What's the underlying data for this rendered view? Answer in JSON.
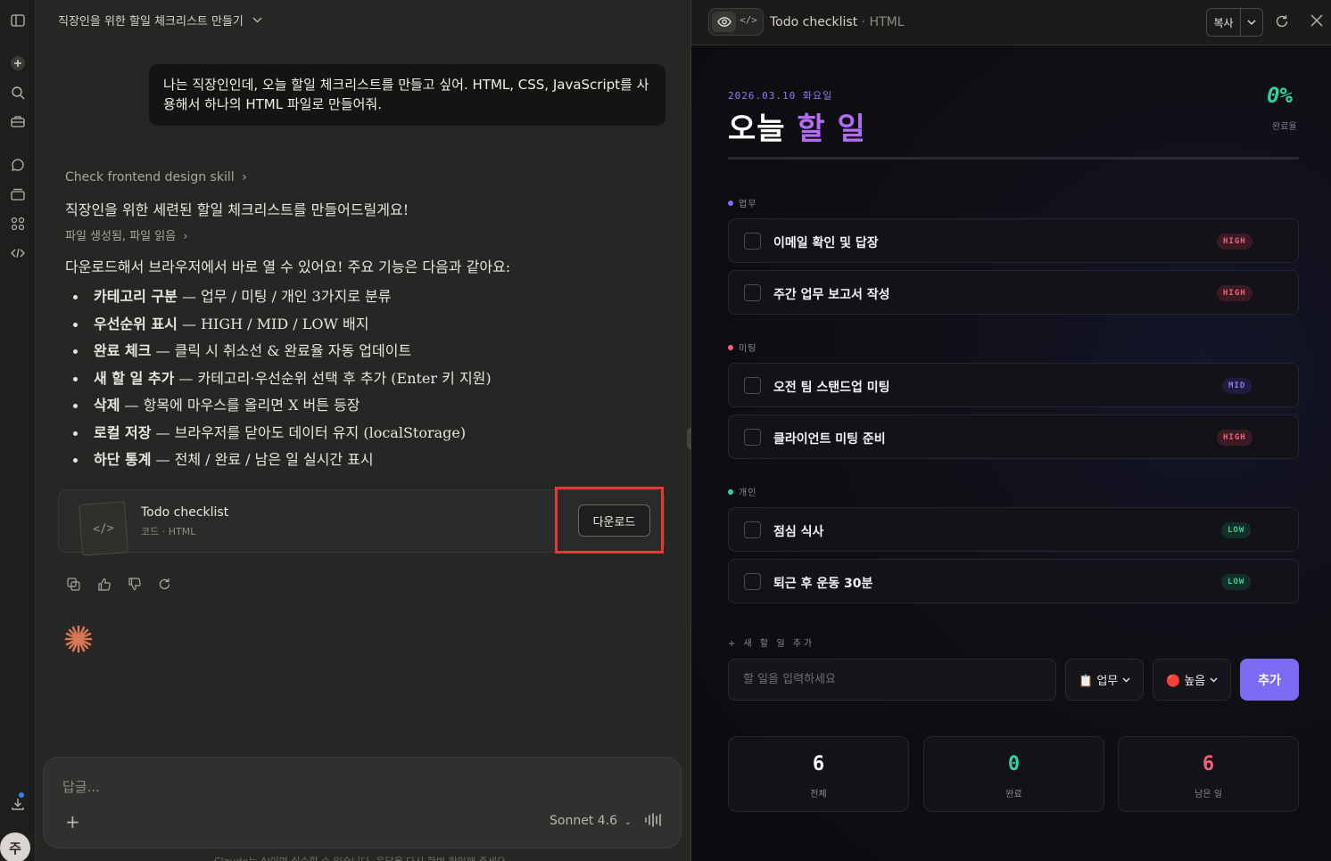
{
  "chat": {
    "title": "직장인을 위한 할일 체크리스트 만들기",
    "user_message": "나는 직장인인데, 오늘 할일 체크리스트를 만들고 싶어. HTML, CSS, JavaScript를 사용해서 하나의 HTML 파일로 만들어줘.",
    "skill_link": "Check frontend design skill",
    "intro": "직장인을 위한 세련된 할일 체크리스트를 만들어드릴게요!",
    "files_link": "파일 생성됨, 파일 읽음",
    "lead": "다운로드해서 브라우저에서 바로 열 수 있어요! 주요 기능은 다음과 같아요:",
    "features": [
      {
        "bold": "카테고리 구분",
        "text": " — 업무 / 미팅 / 개인 3가지로 분류"
      },
      {
        "bold": "우선순위 표시",
        "text": " — HIGH / MID / LOW 배지"
      },
      {
        "bold": "완료 체크",
        "text": " — 클릭 시 취소선 & 완료율 자동 업데이트"
      },
      {
        "bold": "새 할 일 추가",
        "text": " — 카테고리·우선순위 선택 후 추가 (Enter 키 지원)"
      },
      {
        "bold": "삭제",
        "text": " — 항목에 마우스를 올리면 X 버튼 등장"
      },
      {
        "bold": "로컬 저장",
        "text": " — 브라우저를 닫아도 데이터 유지 (localStorage)"
      },
      {
        "bold": "하단 통계",
        "text": " — 전체 / 완료 / 남은 일 실시간 표시"
      }
    ],
    "artifact": {
      "name": "Todo checklist",
      "sub": "코드 · HTML",
      "download_label": "다운로드",
      "thumb": "</>"
    },
    "composer": {
      "placeholder": "답글...",
      "model": "Sonnet 4.6"
    },
    "disclaimer": "Claude는 AI이며 실수할 수 있습니다. 응답을 다시 한번 확인해 주세요."
  },
  "rail": {
    "avatar": "주"
  },
  "preview": {
    "title": "Todo checklist",
    "title_suffix": " · HTML",
    "copy_label": "복사"
  },
  "todo": {
    "date": "2026.03.10 화요일",
    "title_a": "오늘 ",
    "title_b": "할 일",
    "percent": "0%",
    "percent_value": 0,
    "percent_label": "완료율",
    "categories": [
      {
        "label": "업무",
        "color": "#7c6cf5",
        "tasks": [
          {
            "name": "이메일 확인 및 답장",
            "priority": "HIGH"
          },
          {
            "name": "주간 업무 보고서 작성",
            "priority": "HIGH"
          }
        ]
      },
      {
        "label": "미팅",
        "color": "#f0607a",
        "tasks": [
          {
            "name": "오전 팀 스탠드업 미팅",
            "priority": "MID"
          },
          {
            "name": "클라이언트 미팅 준비",
            "priority": "HIGH"
          }
        ]
      },
      {
        "label": "개인",
        "color": "#34d399",
        "tasks": [
          {
            "name": "점심 식사",
            "priority": "LOW"
          },
          {
            "name": "퇴근 후 운동 30분",
            "priority": "LOW"
          }
        ]
      }
    ],
    "add": {
      "label": "+ 새 할 일 추가",
      "placeholder": "할 일을 입력하세요",
      "category_value": "📋 업무",
      "priority_value": "🔴 높음",
      "button": "추가"
    },
    "stats": [
      {
        "value": "6",
        "label": "전체",
        "color": "#ffffff"
      },
      {
        "value": "0",
        "label": "완료",
        "color": "#34d399"
      },
      {
        "value": "6",
        "label": "남은 일",
        "color": "#f0607a"
      }
    ]
  }
}
